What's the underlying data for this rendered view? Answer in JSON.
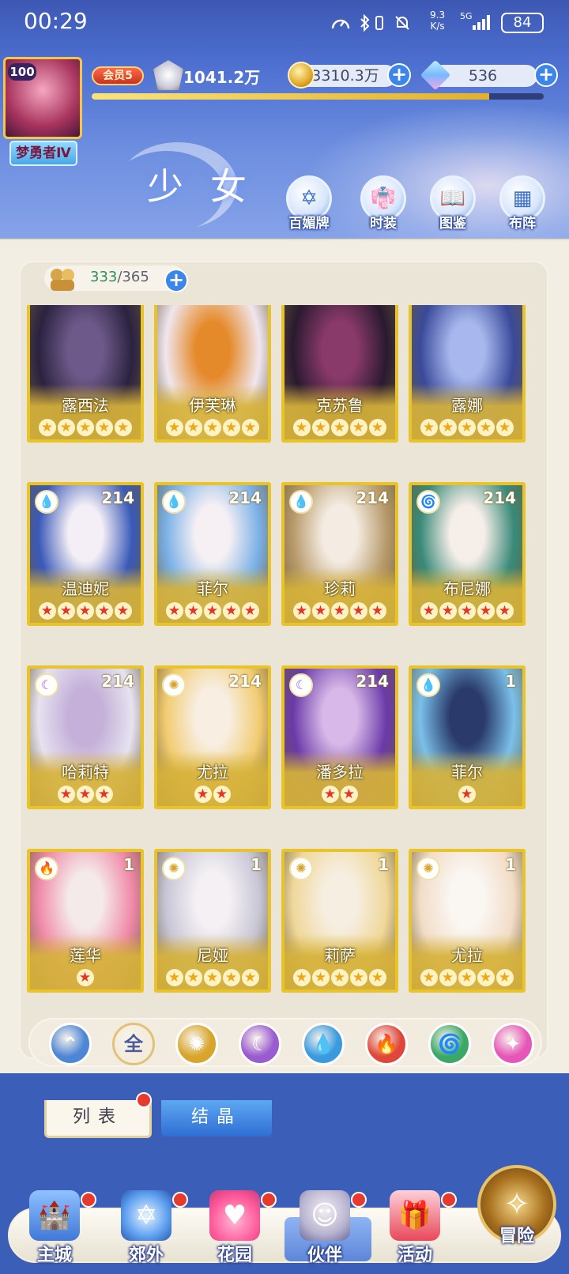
{
  "status_bar": {
    "time": "00:29",
    "net_speed_value": "9.3",
    "net_speed_unit": "K/s",
    "network": "5G",
    "battery": "84"
  },
  "player": {
    "level": "100",
    "title": "梦勇者Ⅳ",
    "vip": "会员5",
    "power": "1041.2万",
    "xp_progress": 0.88
  },
  "resources": {
    "gold": "3310.3万",
    "diamond": "536"
  },
  "page": {
    "title": "少女"
  },
  "top_menu": [
    {
      "label": "百媚牌",
      "icon": "card-deck-icon"
    },
    {
      "label": "时装",
      "icon": "costume-icon"
    },
    {
      "label": "图鉴",
      "icon": "book-icon"
    },
    {
      "label": "布阵",
      "icon": "formation-grid-icon"
    }
  ],
  "collection": {
    "current": "333",
    "total": "/365"
  },
  "cards": [
    {
      "name": "露西法",
      "stars": 5,
      "star_color": "gold",
      "level": "",
      "element": "",
      "palette": [
        "#2b2240",
        "#6e5a8a"
      ]
    },
    {
      "name": "伊芙琳",
      "stars": 5,
      "star_color": "gold",
      "level": "",
      "element": "",
      "palette": [
        "#f0e6ee",
        "#e58a2a"
      ]
    },
    {
      "name": "克苏鲁",
      "stars": 5,
      "star_color": "gold",
      "level": "",
      "element": "",
      "palette": [
        "#2a1a30",
        "#8a3a6a"
      ]
    },
    {
      "name": "露娜",
      "stars": 5,
      "star_color": "gold",
      "level": "",
      "element": "",
      "palette": [
        "#3a4a9a",
        "#a8b8ee"
      ]
    },
    {
      "name": "温迪妮",
      "stars": 5,
      "star_color": "red",
      "level": "214",
      "element": "water",
      "palette": [
        "#3a5ab8",
        "#f4eef6"
      ]
    },
    {
      "name": "菲尔",
      "stars": 5,
      "star_color": "red",
      "level": "214",
      "element": "water",
      "palette": [
        "#7ab0e6",
        "#f6f0f4"
      ]
    },
    {
      "name": "珍莉",
      "stars": 5,
      "star_color": "red",
      "level": "214",
      "element": "water",
      "palette": [
        "#b89a6a",
        "#f4ece2"
      ]
    },
    {
      "name": "布尼娜",
      "stars": 5,
      "star_color": "red",
      "level": "214",
      "element": "wind",
      "palette": [
        "#3a8a7a",
        "#f6eee8"
      ]
    },
    {
      "name": "哈莉特",
      "stars": 3,
      "star_color": "red",
      "level": "214",
      "element": "moon",
      "palette": [
        "#e6e2f0",
        "#c4b0d8"
      ]
    },
    {
      "name": "尤拉",
      "stars": 2,
      "star_color": "red",
      "level": "214",
      "element": "sun",
      "palette": [
        "#f2cc72",
        "#f8eee2"
      ]
    },
    {
      "name": "潘多拉",
      "stars": 2,
      "star_color": "red",
      "level": "214",
      "element": "moon",
      "palette": [
        "#6a3aa8",
        "#d8b8e8"
      ]
    },
    {
      "name": "菲尔",
      "stars": 1,
      "star_color": "red",
      "level": "1",
      "element": "water",
      "palette": [
        "#7ac0ea",
        "#2a3a6a"
      ]
    },
    {
      "name": "莲华",
      "stars": 1,
      "star_color": "red",
      "level": "1",
      "element": "fire",
      "palette": [
        "#f08aa8",
        "#f4eaea"
      ]
    },
    {
      "name": "尼娅",
      "stars": 5,
      "star_color": "gold",
      "level": "1",
      "element": "sun",
      "palette": [
        "#c8c6d6",
        "#f4f0f4"
      ]
    },
    {
      "name": "莉萨",
      "stars": 5,
      "star_color": "gold",
      "level": "1",
      "element": "sun",
      "palette": [
        "#f0d89a",
        "#f6eee0"
      ]
    },
    {
      "name": "尤拉",
      "stars": 5,
      "star_color": "gold",
      "level": "1",
      "element": "sun",
      "palette": [
        "#f2dcc6",
        "#faf6f2"
      ]
    }
  ],
  "filters": [
    {
      "label": "",
      "icon": "wing-icon",
      "color": "#4e86d6"
    },
    {
      "label": "全",
      "icon": "all-icon",
      "color": "#f4ecdc"
    },
    {
      "label": "",
      "icon": "sun-icon",
      "color": "#d8a52a"
    },
    {
      "label": "",
      "icon": "moon-icon",
      "color": "#9a5ad0"
    },
    {
      "label": "",
      "icon": "water-drop-icon",
      "color": "#3a9ae0"
    },
    {
      "label": "",
      "icon": "fire-icon",
      "color": "#e0463a"
    },
    {
      "label": "",
      "icon": "wind-icon",
      "color": "#3aa866"
    },
    {
      "label": "",
      "icon": "star-orb-icon",
      "color": "#e656b8"
    }
  ],
  "tabs": {
    "list": "列表",
    "crystal": "结晶"
  },
  "nav": [
    {
      "label": "主城",
      "icon": "castle-icon"
    },
    {
      "label": "郊外",
      "icon": "magic-circle-icon"
    },
    {
      "label": "花园",
      "icon": "heart-icon"
    },
    {
      "label": "伙伴",
      "icon": "partner-portrait-icon"
    },
    {
      "label": "活动",
      "icon": "gift-box-icon"
    },
    {
      "label": "冒险",
      "icon": "compass-icon"
    }
  ],
  "colors": {
    "accent": "#3b86e8",
    "card_gold": "#e8c42a",
    "star_red": "#e2362a",
    "star_gold": "#f0a81a",
    "badge_red": "#e63a2e"
  }
}
